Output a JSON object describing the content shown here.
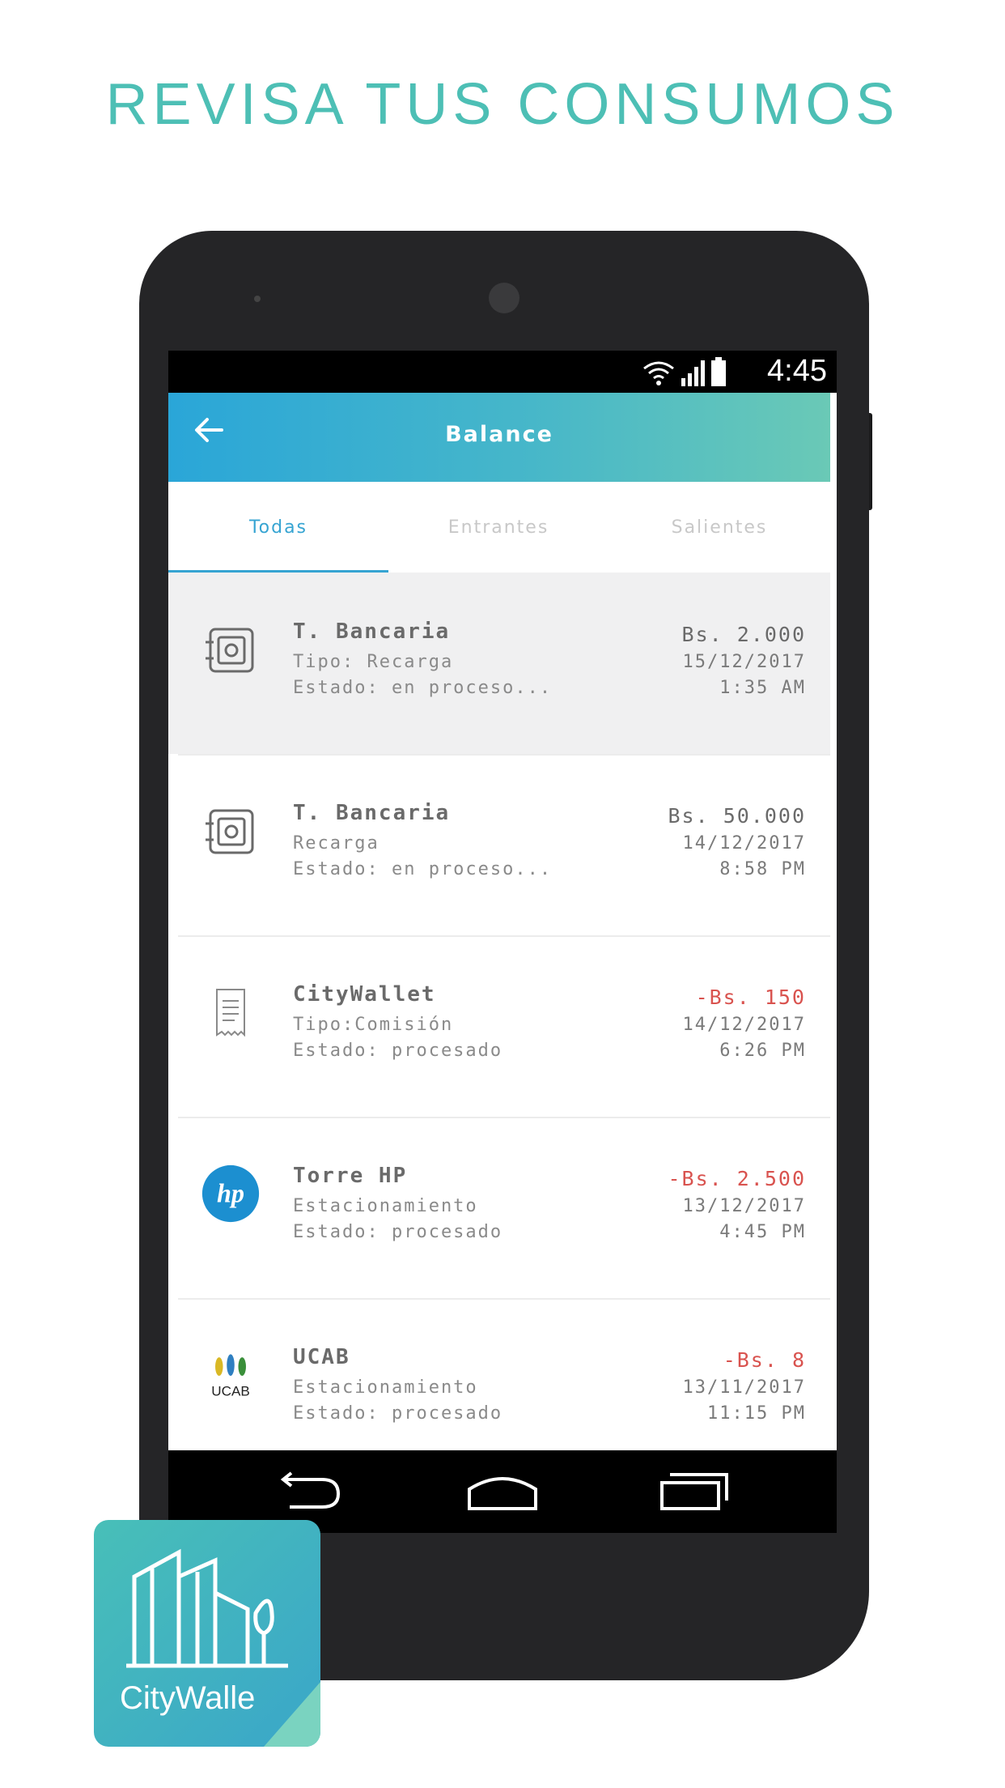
{
  "headline": "REVISA TUS CONSUMOS",
  "status_bar": {
    "time": "4:45"
  },
  "app_bar": {
    "title": "Balance"
  },
  "tabs": [
    {
      "label": "Todas",
      "active": true
    },
    {
      "label": "Entrantes",
      "active": false
    },
    {
      "label": "Salientes",
      "active": false
    }
  ],
  "transactions": [
    {
      "icon": "safe-icon",
      "title": "T. Bancaria",
      "subtitle": "Tipo: Recarga",
      "status": "Estado: en proceso...",
      "amount": "Bs. 2.000",
      "date": "15/12/2017",
      "time": "1:35 AM",
      "negative": false
    },
    {
      "icon": "safe-icon",
      "title": "T. Bancaria",
      "subtitle": "Recarga",
      "status": "Estado: en proceso...",
      "amount": "Bs. 50.000",
      "date": "14/12/2017",
      "time": "8:58 PM",
      "negative": false
    },
    {
      "icon": "receipt-icon",
      "title": "CityWallet",
      "subtitle": "Tipo:Comisión",
      "status": "Estado: procesado",
      "amount": "-Bs. 150",
      "date": "14/12/2017",
      "time": "6:26 PM",
      "negative": true
    },
    {
      "icon": "hp-logo-icon",
      "title": "Torre HP",
      "subtitle": "Estacionamiento",
      "status": "Estado: procesado",
      "amount": "-Bs. 2.500",
      "date": "13/12/2017",
      "time": "4:45 PM",
      "negative": true
    },
    {
      "icon": "ucab-logo-icon",
      "title": "UCAB",
      "subtitle": "Estacionamiento",
      "status": "Estado: procesado",
      "amount": "-Bs. 8",
      "date": "13/11/2017",
      "time": "11:15 PM",
      "negative": true
    }
  ],
  "icon_labels": {
    "hp": "hp",
    "ucab": "UCAB"
  },
  "logo": {
    "text": "CityWalle"
  },
  "colors": {
    "accent": "#36a4d2",
    "negative": "#d9534f",
    "headline": "#4dbfb5"
  }
}
